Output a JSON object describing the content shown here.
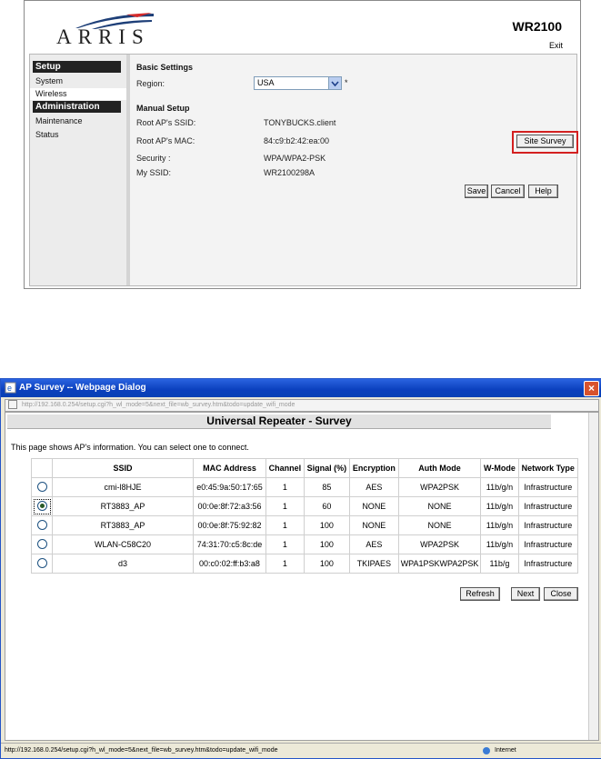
{
  "router": {
    "brand": "ARRIS",
    "model": "WR2100",
    "exit": "Exit",
    "nav": {
      "setup": "Setup",
      "system": "System",
      "wireless": "Wireless",
      "administration": "Administration",
      "maintenance": "Maintenance",
      "status": "Status"
    },
    "basic_settings": "Basic Settings",
    "region_label": "Region:",
    "region_value": "USA",
    "region_required": "*",
    "manual_setup": "Manual Setup",
    "root_ssid_label": "Root AP's SSID:",
    "root_ssid_value": "TONYBUCKS.client",
    "root_mac_label": "Root AP's MAC:",
    "root_mac_value": "84:c9:b2:42:ea:00",
    "security_label": "Security :",
    "security_value": "WPA/WPA2-PSK",
    "my_ssid_label": "My SSID:",
    "my_ssid_value": "WR2100298A",
    "site_survey": "Site Survey",
    "save": "Save",
    "cancel": "Cancel",
    "help": "Help"
  },
  "dialog": {
    "title": "AP Survey -- Webpage Dialog",
    "url": "http://192.168.0.254/setup.cgi?h_wl_mode=5&next_file=wb_survey.htm&todo=update_wifi_mode",
    "heading": "Universal Repeater - Survey",
    "intro": "This page shows AP's information. You can select one to connect.",
    "columns": [
      "SSID",
      "MAC Address",
      "Channel",
      "Signal (%)",
      "Encryption",
      "Auth Mode",
      "W-Mode",
      "Network Type"
    ],
    "rows": [
      {
        "selected": false,
        "ssid": "cmi-l8HJE",
        "mac": "e0:45:9a:50:17:65",
        "channel": "1",
        "signal": "85",
        "encryption": "AES",
        "auth": "WPA2PSK",
        "wmode": "11b/g/n",
        "network": "Infrastructure"
      },
      {
        "selected": true,
        "ssid": "RT3883_AP",
        "mac": "00:0e:8f:72:a3:56",
        "channel": "1",
        "signal": "60",
        "encryption": "NONE",
        "auth": "NONE",
        "wmode": "11b/g/n",
        "network": "Infrastructure"
      },
      {
        "selected": false,
        "ssid": "RT3883_AP",
        "mac": "00:0e:8f:75:92:82",
        "channel": "1",
        "signal": "100",
        "encryption": "NONE",
        "auth": "NONE",
        "wmode": "11b/g/n",
        "network": "Infrastructure"
      },
      {
        "selected": false,
        "ssid": "WLAN-C58C20",
        "mac": "74:31:70:c5:8c:de",
        "channel": "1",
        "signal": "100",
        "encryption": "AES",
        "auth": "WPA2PSK",
        "wmode": "11b/g/n",
        "network": "Infrastructure"
      },
      {
        "selected": false,
        "ssid": "d3",
        "mac": "00:c0:02:ff:b3:a8",
        "channel": "1",
        "signal": "100",
        "encryption": "TKIPAES",
        "auth": "WPA1PSKWPA2PSK",
        "wmode": "11b/g",
        "network": "Infrastructure"
      }
    ],
    "refresh": "Refresh",
    "next": "Next",
    "close": "Close",
    "status_url": "http://192.168.0.254/setup.cgi?h_wl_mode=5&next_file=wb_survey.htm&todo=update_wifi_mode",
    "zone": "Internet"
  }
}
